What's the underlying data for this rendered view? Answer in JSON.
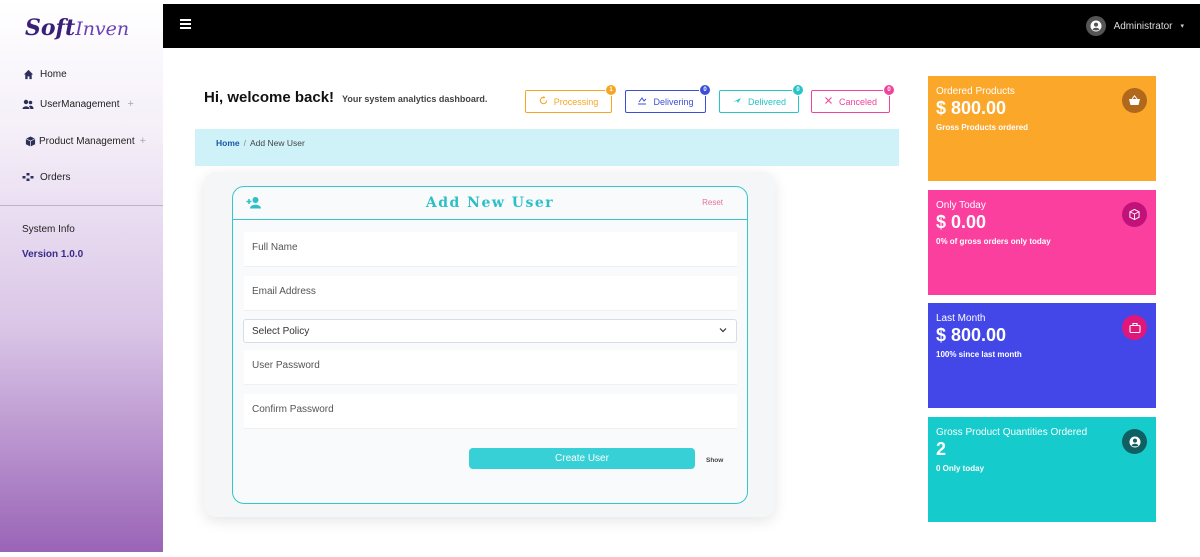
{
  "brand": {
    "part1": "Soft",
    "part2": "Inven"
  },
  "sidebar": {
    "items": [
      {
        "label": "Home",
        "icon": "home-icon"
      },
      {
        "label": "UserManagement",
        "icon": "users-icon",
        "expand": "+"
      },
      {
        "label": "Product Management",
        "icon": "box-icon",
        "expand": "+"
      },
      {
        "label": "Orders",
        "icon": "orders-icon"
      }
    ],
    "system_info": "System Info",
    "version": "Version 1.0.0"
  },
  "topbar": {
    "user": "Administrator"
  },
  "header": {
    "welcome": "Hi, welcome back!",
    "subtitle": "Your system analytics dashboard."
  },
  "statuses": [
    {
      "label": "Processing",
      "count": "1",
      "color": "#f5a623"
    },
    {
      "label": "Delivering",
      "count": "0",
      "color": "#3d4fd6"
    },
    {
      "label": "Delivered",
      "count": "0",
      "color": "#27c4c9"
    },
    {
      "label": "Canceled",
      "count": "0",
      "color": "#f0439b"
    }
  ],
  "breadcrumb": {
    "home": "Home",
    "separator": "/",
    "current": "Add New User"
  },
  "form": {
    "title": "Add New User",
    "reset": "Reset",
    "full_name_placeholder": "Full Name",
    "email_placeholder": "Email Address",
    "policy_value": "Select Policy",
    "password_placeholder": "User Password",
    "confirm_placeholder": "Confirm Password",
    "submit": "Create User",
    "show": "Show"
  },
  "stats": [
    {
      "label": "Ordered Products",
      "value": "$ 800.00",
      "note": "Gross Products ordered",
      "bg": "#fba72a",
      "circle": "#b0691b",
      "icon": "basket-icon"
    },
    {
      "label": "Only Today",
      "value": "$ 0.00",
      "note": "0% of gross orders only today",
      "bg": "#fb3f9f",
      "circle": "#c1127a",
      "icon": "cube-icon"
    },
    {
      "label": "Last Month",
      "value": "$ 800.00",
      "note": "100% since last month",
      "bg": "#4347e8",
      "circle": "#e0167a",
      "icon": "bag-icon"
    },
    {
      "label": "Gross Product Quantities Ordered",
      "value": "2",
      "note": "0 Only today",
      "bg": "#16cbcb",
      "circle": "#0f5f63",
      "icon": "user-circle-icon"
    }
  ]
}
